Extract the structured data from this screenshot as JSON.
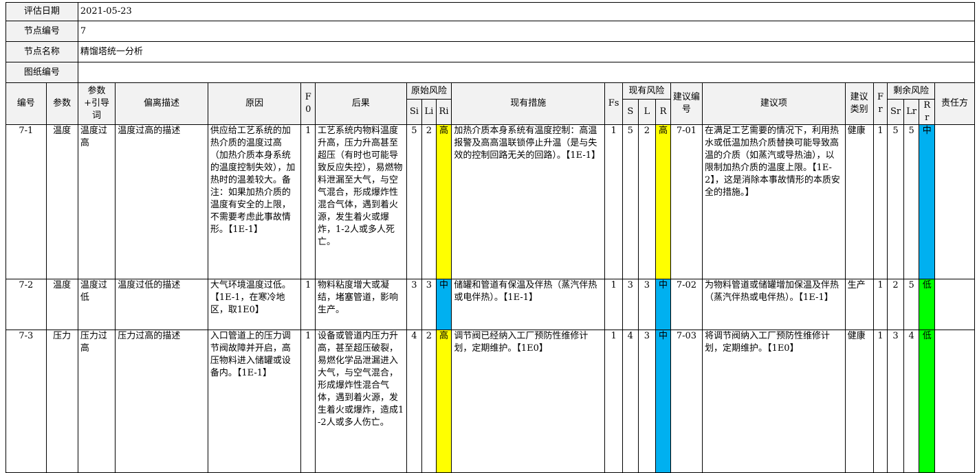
{
  "meta": [
    {
      "label": "评估日期",
      "value": "2021-05-23"
    },
    {
      "label": "节点编号",
      "value": "7"
    },
    {
      "label": "节点名称",
      "value": "精馏塔统一分析"
    },
    {
      "label": "图纸编号",
      "value": ""
    }
  ],
  "headers": {
    "no": "编号",
    "param": "参数",
    "guide": "参数+引导词",
    "dev": "偏离描述",
    "cause": "原因",
    "f0": "F0",
    "cons": "后果",
    "orig": "原始风险",
    "si": "Si",
    "li": "Li",
    "ri": "Ri",
    "meas": "现有措施",
    "fs": "Fs",
    "curr": "现有风险",
    "s": "S",
    "l": "L",
    "r": "R",
    "recno": "建议编号",
    "rec": "建议项",
    "rtype": "建议类别",
    "fr": "Fr",
    "res": "剩余风险",
    "sr": "Sr",
    "lr": "Lr",
    "rr": "Rr",
    "resp": "责任方"
  },
  "rows": [
    {
      "no": "7-1",
      "param": "温度",
      "guide": "温度过高",
      "dev": "温度过高的描述",
      "cause": "供应给工艺系统的加热介质的温度过高（加热介质本身系统的温度控制失效），加热时的温差较大。备注：如果加热介质的温度有安全的上限，不需要考虑此事故情形。【1E-1】",
      "f0": "1",
      "cons": "工艺系统内物料温度升高，压力升高甚至超压（有时也可能导致反应失控），易燃物料泄漏至大气，与空气混合，形成爆炸性混合气体，遇到着火源，发生着火或爆炸，1-2人或多人死亡。",
      "si": "5",
      "li": "2",
      "ri": "高",
      "meas": "加热介质本身系统有温度控制：高温报警及高高温联锁停止升温（是与失效的控制回路无关的回路）。【1E-1】",
      "fs": "1",
      "s": "5",
      "l": "2",
      "r": "高",
      "recno": "7-01",
      "rec": "在满足工艺需要的情况下，利用热水或低温加热介质替换可能导致高温的介质（如蒸汽或导热油），以限制加热介质的温度上限。【1E-2】，这是消除本事故情形的本质安全的措施。】",
      "rtype": "健康",
      "fr": "1",
      "sr": "5",
      "lr": "5",
      "rr": "中",
      "resp": ""
    },
    {
      "no": "7-2",
      "param": "温度",
      "guide": "温度过低",
      "dev": "温度过低的描述",
      "cause": "大气环境温度过低。【1E-1，在寒冷地区，取1E0】",
      "f0": "1",
      "cons": "物料粘度增大或凝结，堵塞管道，影响生产。",
      "si": "3",
      "li": "3",
      "ri": "中",
      "meas": "储罐和管道有保温及伴热（蒸汽伴热或电伴热）。【1E-1】",
      "fs": "1",
      "s": "3",
      "l": "3",
      "r": "中",
      "recno": "7-02",
      "rec": "为物料管道或储罐增加保温及伴热（蒸汽伴热或电伴热）。【1E-1】",
      "rtype": "生产",
      "fr": "1",
      "sr": "2",
      "lr": "5",
      "rr": "低",
      "resp": ""
    },
    {
      "no": "7-3",
      "param": "压力",
      "guide": "压力过高",
      "dev": "压力过高的描述",
      "cause": "入口管道上的压力调节阀故障并开启，高压物料进入储罐或设备内。【1E-1】",
      "f0": "1",
      "cons": "设备或管道内压力升高，甚至超压破裂，易燃化学品泄漏进入大气，与空气混合，形成爆炸性混合气体，遇到着火源，发生着火或爆炸，造成1-2人或多人伤亡。",
      "si": "4",
      "li": "2",
      "ri": "高",
      "meas": "调节阀已经纳入工厂预防性维修计划，定期维护。【1E0】",
      "fs": "1",
      "s": "4",
      "l": "3",
      "r": "中",
      "recno": "7-03",
      "rec": "将调节阀纳入工厂预防性维修计划，定期维护。【1E0】",
      "rtype": "健康",
      "fr": "1",
      "sr": "3",
      "lr": "4",
      "rr": "低",
      "resp": ""
    }
  ],
  "colors": {
    "high": "#ffff00",
    "mid": "#00b0f0",
    "low": "#00ff00",
    "header_bg": "#f2f2f2"
  }
}
